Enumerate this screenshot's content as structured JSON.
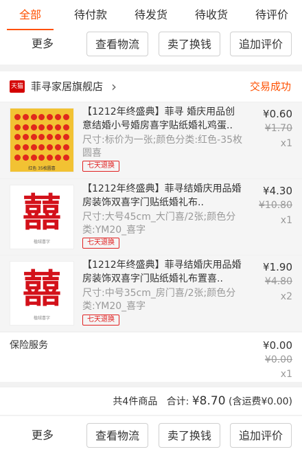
{
  "tabs": [
    "全部",
    "待付款",
    "待发货",
    "待收货",
    "待评价"
  ],
  "actions": {
    "more": "更多",
    "logistics": "查看物流",
    "resell": "卖了换钱",
    "review": "追加评价"
  },
  "shop": {
    "badge": "天猫",
    "name": "菲寻家居旗舰店",
    "status": "交易成功"
  },
  "items": [
    {
      "title": "【1212年终盛典】菲寻 婚庆用品创意结婚小号婚房喜字贴纸婚礼鸡蛋..",
      "sku": "尺寸:标价为一张;颜色分类:红色-35枚圆喜",
      "badge": "七天退换",
      "price": "¥0.60",
      "original_price": "¥1.70",
      "qty": "x1",
      "thumb_caption": "红色 35枚圆喜"
    },
    {
      "title": "【1212年终盛典】菲寻结婚庆用品婚房装饰双喜字门贴纸婚礼布..",
      "sku": "尺寸:大号45cm_大门喜/2张;颜色分类:YM20_喜字",
      "badge": "七天退换",
      "price": "¥4.30",
      "original_price": "¥10.80",
      "qty": "x1",
      "thumb_glyph": "囍",
      "thumb_caption": "植绒喜字"
    },
    {
      "title": "【1212年终盛典】菲寻结婚庆用品婚房装饰双喜字门贴纸婚礼布置喜..",
      "sku": "尺寸:中号35cm_房门喜/2张;颜色分类:YM20_喜字",
      "badge": "七天退换",
      "price": "¥1.90",
      "original_price": "¥4.80",
      "qty": "x2",
      "thumb_glyph": "囍",
      "thumb_caption": "植绒喜字"
    }
  ],
  "insurance": {
    "label": "保险服务",
    "price": "¥0.00",
    "original_price": "¥0.00",
    "qty": "x1"
  },
  "summary": {
    "count": "共4件商品",
    "total_label": "合计: ",
    "total_amount": "¥8.70",
    "shipping": "(含运费¥0.00)"
  },
  "colors": {
    "accent": "#ff5000",
    "badge_red": "#e02020"
  }
}
